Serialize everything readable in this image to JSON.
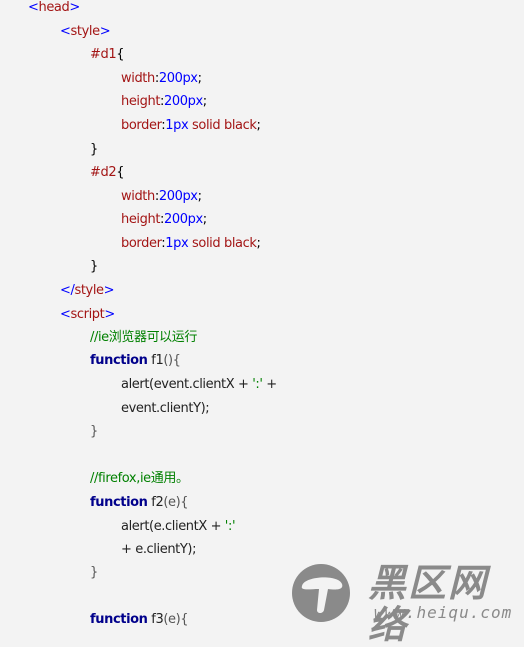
{
  "colors": {
    "background": "#f3f3f3",
    "tag_bracket": "#0000ff",
    "tag_name": "#a31515",
    "css_value": "#0000ff",
    "comment": "#008000",
    "keyword": "#00008b"
  },
  "code": {
    "head_open": "head",
    "style_open": "style",
    "d1_selector": "#d1",
    "d1_width_prop": "width",
    "d1_width_val": "200px",
    "d1_height_prop": "height",
    "d1_height_val": "200px",
    "d1_border_prop": "border",
    "d1_border_val": "1px",
    "d1_border_rest": " solid black",
    "d2_selector": "#d2",
    "d2_width_prop": "width",
    "d2_width_val": "200px",
    "d2_height_prop": "height",
    "d2_height_val": "200px",
    "d2_border_prop": "border",
    "d2_border_val": "1px",
    "d2_border_rest": " solid black",
    "style_close": "style",
    "script_open": "script",
    "comment_ie": "//ie浏览器可以运行",
    "f1_keyword": "function",
    "f1_name": " f1",
    "f1_params": "(){",
    "f1_line1_a": "alert(event.clientX + ",
    "f1_line1_str": "':'",
    "f1_line1_b": " +",
    "f1_line2": "event.clientY);",
    "f1_close": "}",
    "comment_ff": "//firefox,ie通用。",
    "f2_keyword": "function",
    "f2_name": " f2",
    "f2_params": "(e){",
    "f2_line1_a": "alert(e.clientX + ",
    "f2_line1_str": "':'",
    "f2_line2": "+ e.clientY);",
    "f2_close": "}",
    "f3_keyword": "function",
    "f3_name": " f3",
    "f3_params": "(e){"
  },
  "watermark": {
    "logo_icon": "mushroom-icon",
    "brand_cn": "黑区网络",
    "url": "www.heiqu.com"
  }
}
